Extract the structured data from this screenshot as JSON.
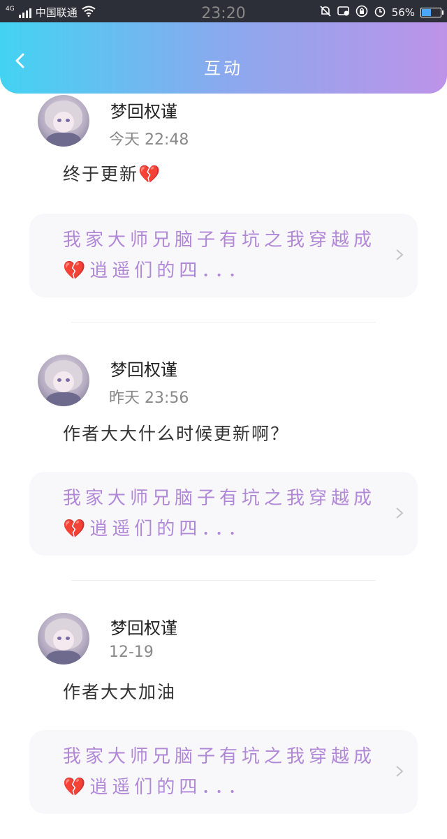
{
  "status_bar": {
    "network": "4G",
    "carrier": "中国联通",
    "time": "23:20",
    "battery_text": "56%",
    "battery_level": 0.56
  },
  "header": {
    "title": "互动"
  },
  "posts": [
    {
      "name": "梦回权谨",
      "time": "今天 22:48",
      "comment": "终于更新💔",
      "card_text": "我家大师兄脑子有坑之我穿越成💔逍遥们的四．．．"
    },
    {
      "name": "梦回权谨",
      "time": "昨天 23:56",
      "comment": "作者大大什么时候更新啊？",
      "card_text": "我家大师兄脑子有坑之我穿越成💔逍遥们的四．．．"
    },
    {
      "name": "梦回权谨",
      "time": "12-19",
      "comment": "作者大大加油",
      "card_text": "我家大师兄脑子有坑之我穿越成💔逍遥们的四．．．"
    }
  ],
  "colors": {
    "accent_start": "#43d3f2",
    "accent_end": "#bd93e8",
    "link_text": "#b188d8"
  }
}
